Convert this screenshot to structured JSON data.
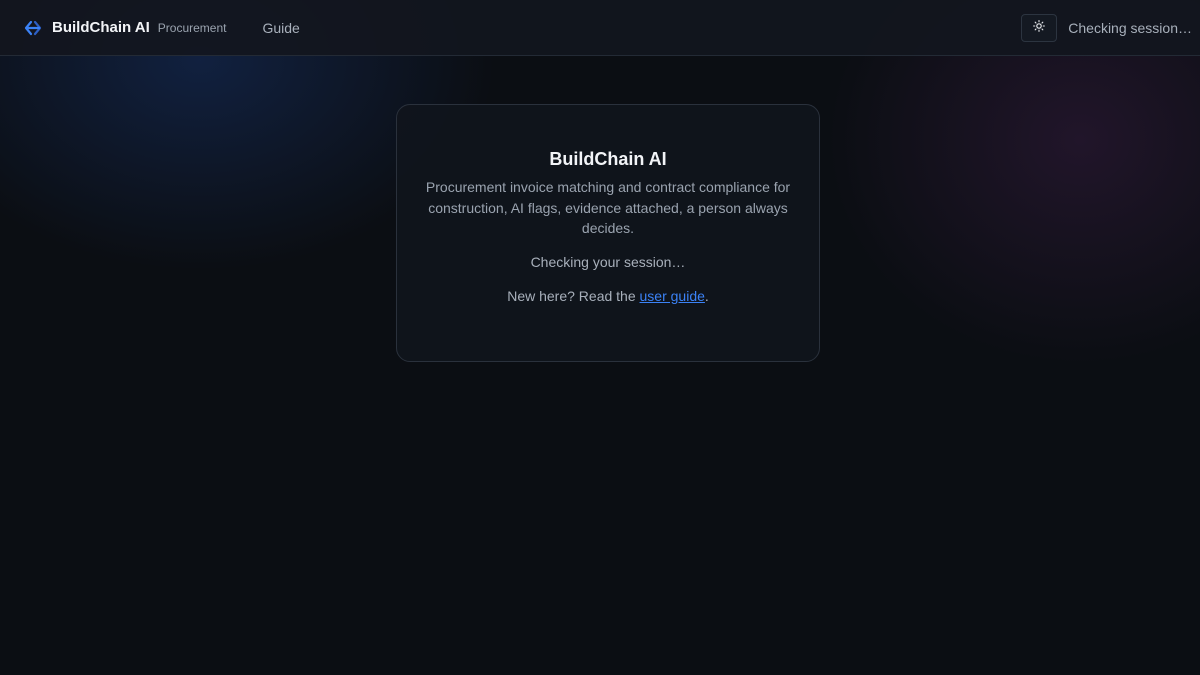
{
  "header": {
    "brand_name": "BuildChain AI",
    "brand_tag": "Procurement",
    "nav_guide": "Guide",
    "theme_toggle_icon": "sun-icon",
    "session_status": "Checking session…"
  },
  "card": {
    "title": "BuildChain AI",
    "description": "Procurement invoice matching and contract compliance for construction, AI flags, evidence attached, a person always decides.",
    "status": "Checking your session…",
    "guide_prefix": "New here? Read the ",
    "guide_link": "user guide",
    "guide_suffix": "."
  },
  "colors": {
    "accent": "#3b82f6",
    "background": "#0b0e13"
  }
}
